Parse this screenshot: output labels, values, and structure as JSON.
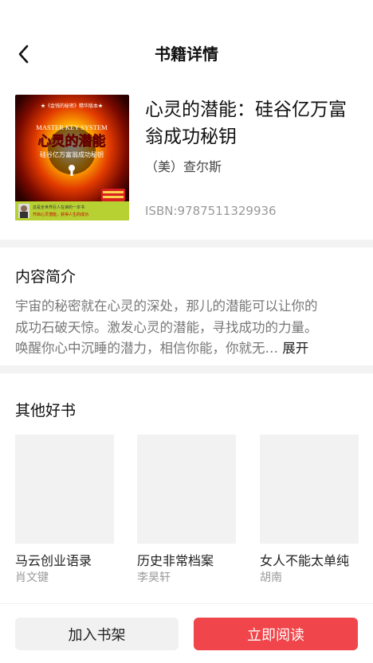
{
  "header": {
    "title": "书籍详情"
  },
  "book": {
    "title": "心灵的潜能：硅谷亿万富翁成功秘钥",
    "author": "（美）查尔斯",
    "isbn": "ISBN:9787511329936",
    "cover": {
      "series": "★《金钱的秘密》精华版本★",
      "english_title": "MASTER KEY SYSTEM",
      "cn_title": "心灵的潜能",
      "cn_subtitle": "硅谷亿万富翁成功秘钥",
      "footer_line1": "这是全世界巨人在读的一本书",
      "footer_line2": "开启心灵潜能，获得人生的成功"
    }
  },
  "intro": {
    "heading": "内容简介",
    "line1": "宇宙的秘密就在心灵的深处，那儿的潜能可以让你的",
    "line2": "成功石破天惊。激发心灵的潜能，寻找成功的力量。",
    "line3": "唤醒你心中沉睡的潜力，相信你能，你就无…",
    "expand": "展开"
  },
  "others": {
    "heading": "其他好书",
    "books": [
      {
        "title": "马云创业语录",
        "author": "肖文键"
      },
      {
        "title": "历史非常档案",
        "author": "李昊轩"
      },
      {
        "title": "女人不能太单纯",
        "author": "胡南"
      }
    ]
  },
  "bottom": {
    "add_shelf": "加入书架",
    "read_now": "立即阅读"
  },
  "colors": {
    "accent": "#f0454a",
    "divider": "#f3f3f3",
    "placeholder": "#f2f2f2"
  }
}
